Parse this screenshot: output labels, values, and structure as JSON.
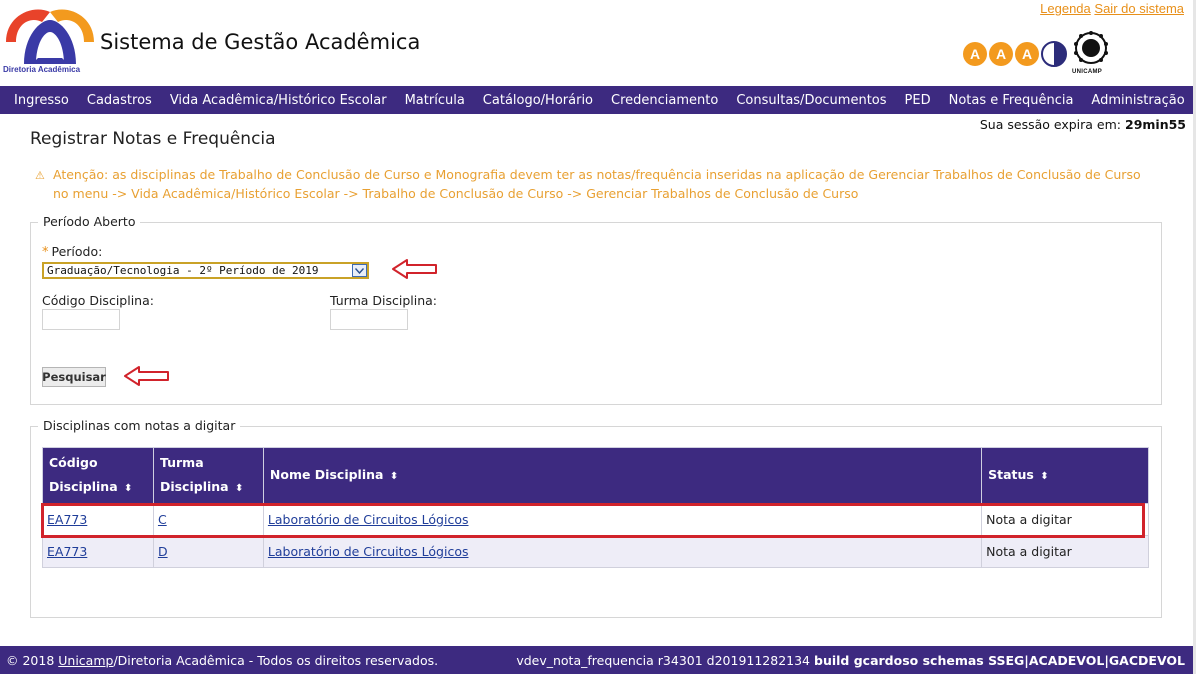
{
  "header": {
    "logo_caption": "Diretoria Acadêmica",
    "title": "Sistema de Gestão Acadêmica",
    "links": {
      "legend": "Legenda",
      "logout": "Sair do sistema"
    },
    "a11y": {
      "font_a": "A",
      "font_b": "A",
      "font_c": "A"
    },
    "unicamp_caption": "UNICAMP"
  },
  "nav": {
    "items": [
      "Ingresso",
      "Cadastros",
      "Vida Acadêmica/Histórico Escolar",
      "Matrícula",
      "Catálogo/Horário",
      "Credenciamento",
      "Consultas/Documentos",
      "PED",
      "Notas e Frequência",
      "Administração"
    ]
  },
  "session": {
    "label": "Sua sessão expira em:",
    "time": "29min55"
  },
  "page": {
    "title": "Registrar Notas e Frequência",
    "warning_line1": "Atenção: as disciplinas de Trabalho de Conclusão de Curso e Monografia devem ter as notas/frequência inseridas na aplicação de Gerenciar Trabalhos de Conclusão de Curso",
    "warning_line2": "no menu -> Vida Acadêmica/Histórico Escolar -> Trabalho de Conclusão de Curso -> Gerenciar Trabalhos de Conclusão de Curso"
  },
  "filter": {
    "legend": "Período Aberto",
    "required_mark": "*",
    "period_label": "Período:",
    "period_value": "Graduação/Tecnologia - 2º Período de 2019",
    "code_label": "Código Disciplina:",
    "class_label": "Turma Disciplina:",
    "search_button": "Pesquisar"
  },
  "results": {
    "legend": "Disciplinas com notas a digitar",
    "columns": [
      {
        "line1": "Código",
        "line2": "Disciplina"
      },
      {
        "line1": "Turma",
        "line2": "Disciplina"
      },
      {
        "line1": "Nome Disciplina",
        "line2": ""
      },
      {
        "line1": "Status",
        "line2": ""
      }
    ],
    "sort_glyph": "⬍",
    "rows": [
      {
        "code": "EA773",
        "class": "C",
        "name": "Laboratório de Circuitos Lógicos",
        "status": "Nota a digitar"
      },
      {
        "code": "EA773",
        "class": "D",
        "name": "Laboratório de Circuitos Lógicos",
        "status": "Nota a digitar"
      }
    ]
  },
  "footer": {
    "copyright_pre": "© 2018 ",
    "unicamp": "Unicamp",
    "copyright_post": "/Diretoria Acadêmica - Todos os direitos reservados.",
    "version": "vdev_nota_frequencia r34301 d201911282134",
    "build": "build gcardoso schemas SSEG|ACADEVOL|GACDEVOL"
  },
  "colors": {
    "nav_bg": "#3d2a80",
    "accent_orange": "#e8901a",
    "highlight_red": "#d1232b",
    "link_blue": "#1f3d99"
  }
}
